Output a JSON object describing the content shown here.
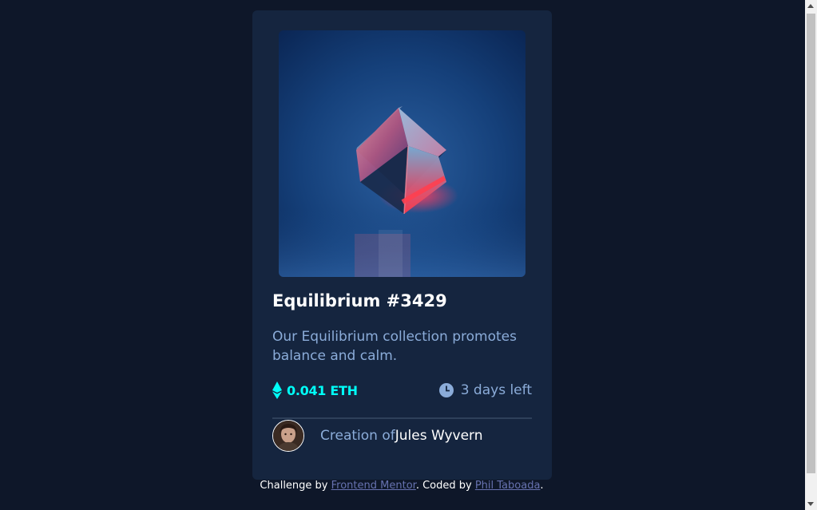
{
  "card": {
    "image_alt": "Equilibrium cube",
    "title": "Equilibrium #3429",
    "description": "Our Equilibrium collection promotes balance and calm.",
    "price": "0.041 ETH",
    "time_left": "3 days left",
    "creator_prefix": "Creation of",
    "creator_name": "Jules Wyvern"
  },
  "icons": {
    "eth": "ethereum-icon",
    "clock": "clock-icon"
  },
  "attribution": {
    "prefix": "Challenge by ",
    "frontend_mentor": "Frontend Mentor",
    "middle": ". Coded by ",
    "author": "Phil Taboada",
    "suffix": "."
  },
  "colors": {
    "page_bg": "#0e1729",
    "card_bg": "#15253f",
    "cyan": "#00fff8",
    "soft_blue": "#8bacd9",
    "link": "#6772b0"
  }
}
